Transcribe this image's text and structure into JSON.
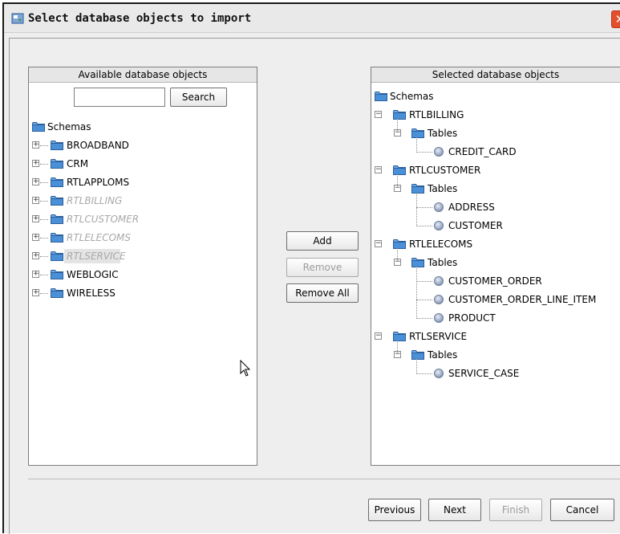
{
  "window": {
    "title": "Select database objects to import",
    "close_label": "✕"
  },
  "left_panel": {
    "header": "Available database objects",
    "search_value": "",
    "search_label": "Search",
    "root_label": "Schemas",
    "schemas": [
      {
        "label": "BROADBAND",
        "enabled": true
      },
      {
        "label": "CRM",
        "enabled": true
      },
      {
        "label": "RTLAPPLOMS",
        "enabled": true
      },
      {
        "label": "RTLBILLING",
        "enabled": false
      },
      {
        "label": "RTLCUSTOMER",
        "enabled": false
      },
      {
        "label": "RTLELECOMS",
        "enabled": false
      },
      {
        "label": "RTLSERVICE",
        "enabled": false
      },
      {
        "label": "WEBLOGIC",
        "enabled": true
      },
      {
        "label": "WIRELESS",
        "enabled": true
      }
    ]
  },
  "middle_buttons": {
    "add": "Add",
    "remove": "Remove",
    "remove_all": "Remove All"
  },
  "right_panel": {
    "header": "Selected database objects",
    "root_label": "Schemas",
    "schemas": [
      {
        "label": "RTLBILLING",
        "group": "Tables",
        "tables": [
          "CREDIT_CARD"
        ]
      },
      {
        "label": "RTLCUSTOMER",
        "group": "Tables",
        "tables": [
          "ADDRESS",
          "CUSTOMER"
        ]
      },
      {
        "label": "RTLELECOMS",
        "group": "Tables",
        "tables": [
          "CUSTOMER_ORDER",
          "CUSTOMER_ORDER_LINE_ITEM",
          "PRODUCT"
        ]
      },
      {
        "label": "RTLSERVICE",
        "group": "Tables",
        "tables": [
          "SERVICE_CASE"
        ]
      }
    ]
  },
  "footer": {
    "previous": "Previous",
    "next": "Next",
    "finish": "Finish",
    "cancel": "Cancel"
  },
  "colors": {
    "folder": "#4a90d9",
    "folder_tab": "#6aaae8",
    "close": "#e3502e"
  }
}
